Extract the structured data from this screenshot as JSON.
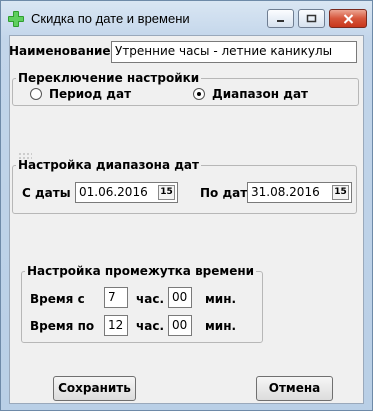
{
  "window": {
    "title": "Скидка по дате и времени"
  },
  "name_field": {
    "label": "Наименование",
    "value": "Утренние часы - летние каникулы"
  },
  "mode_group": {
    "legend": "Переключение настройки",
    "options": [
      {
        "label": "Период дат",
        "selected": false
      },
      {
        "label": "Диапазон дат",
        "selected": true
      }
    ]
  },
  "date_range": {
    "legend": "Настройка диапазона дат",
    "from_label": "С даты",
    "from_value": "01.06.2016",
    "to_label": "По дату",
    "to_value": "31.08.2016",
    "calendar_glyph": "15"
  },
  "time_range": {
    "legend": "Настройка промежутка времени",
    "start_label": "Время с",
    "start_hours": "7",
    "start_minutes": "00",
    "end_label": "Время по",
    "end_hours": "12",
    "end_minutes": "00",
    "hours_unit": "час.",
    "minutes_unit": "мин."
  },
  "buttons": {
    "save": "Сохранить",
    "cancel": "Отмена"
  },
  "icons": {
    "app": "green-cross-icon",
    "minimize": "minimize-icon",
    "maximize": "maximize-icon",
    "close": "close-icon",
    "calendar": "calendar-icon"
  }
}
